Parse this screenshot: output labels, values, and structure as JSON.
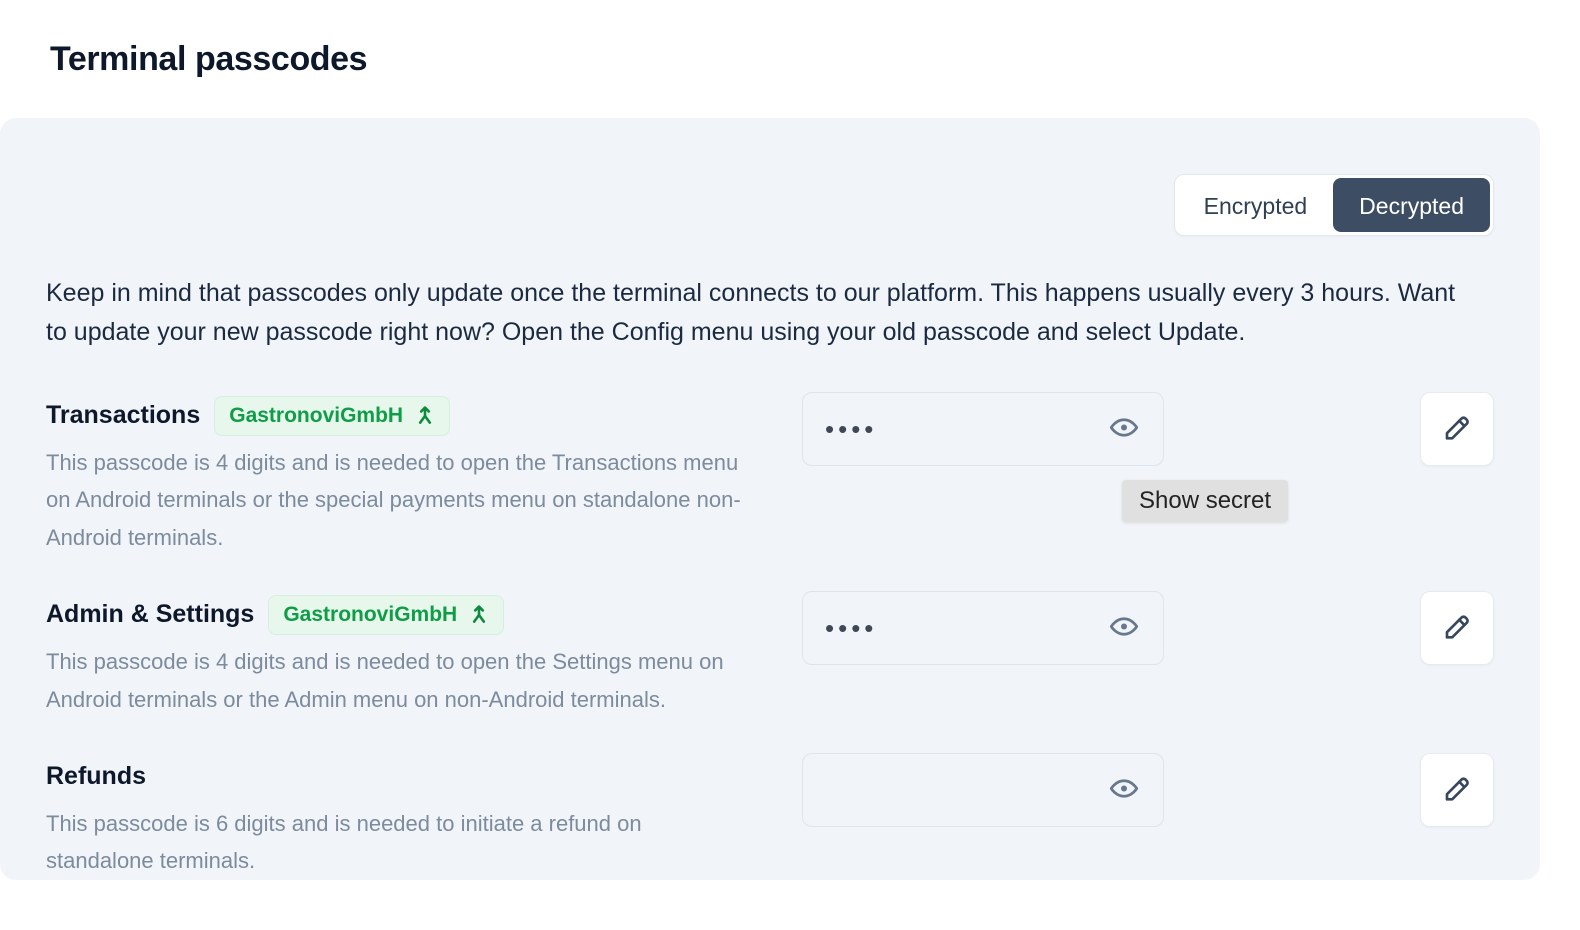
{
  "header": {
    "title": "Terminal passcodes"
  },
  "toggle": {
    "options": [
      {
        "label": "Encrypted",
        "active": false
      },
      {
        "label": "Decrypted",
        "active": true
      }
    ],
    "encrypted_label": "Encrypted",
    "decrypted_label": "Decrypted",
    "active_bg": "#3d4d64",
    "active_text": "#ffffff"
  },
  "intro": {
    "text": "Keep in mind that passcodes only update once the terminal connects to our platform. This happens usually every 3 hours. Want to update your new passcode right now? Open the Config menu using your old passcode and select Update."
  },
  "tooltip": {
    "text": "Show secret",
    "bg": "#e0e0e0",
    "color": "#232323"
  },
  "colors": {
    "panel_bg": "#f1f4f8",
    "page_bg": "#ffffff",
    "title": "#0d182b",
    "muted_text": "#7c8b9e",
    "badge_bg": "#e7f7ec",
    "badge_text": "#0f9d48",
    "badge_icon": "#0d8a3e",
    "eye_icon": "#67788c",
    "pencil_icon": "#37475e"
  },
  "rows": [
    {
      "title": "Transactions",
      "badge": {
        "label": "GastronoviGmbH",
        "icon": "merge-arrow-icon"
      },
      "description": "This passcode is 4 digits and is needed to open the Transactions menu on Android terminals or the special payments menu on standalone non-Android terminals.",
      "value_masked": "••••",
      "digits": 4,
      "eye_icon": "eye-icon",
      "edit_icon": "pencil-icon",
      "tooltip_visible": true
    },
    {
      "title": "Admin & Settings",
      "badge": {
        "label": "GastronoviGmbH",
        "icon": "merge-arrow-icon"
      },
      "description": "This passcode is 4 digits and is needed to open the Settings menu on Android terminals or the Admin menu on non-Android terminals.",
      "value_masked": "••••",
      "digits": 4,
      "eye_icon": "eye-icon",
      "edit_icon": "pencil-icon",
      "tooltip_visible": false
    },
    {
      "title": "Refunds",
      "badge": null,
      "description": "This passcode is 6 digits and is needed to initiate a refund on standalone terminals.",
      "value_masked": "",
      "digits": 6,
      "eye_icon": "eye-icon",
      "edit_icon": "pencil-icon",
      "tooltip_visible": false
    }
  ]
}
